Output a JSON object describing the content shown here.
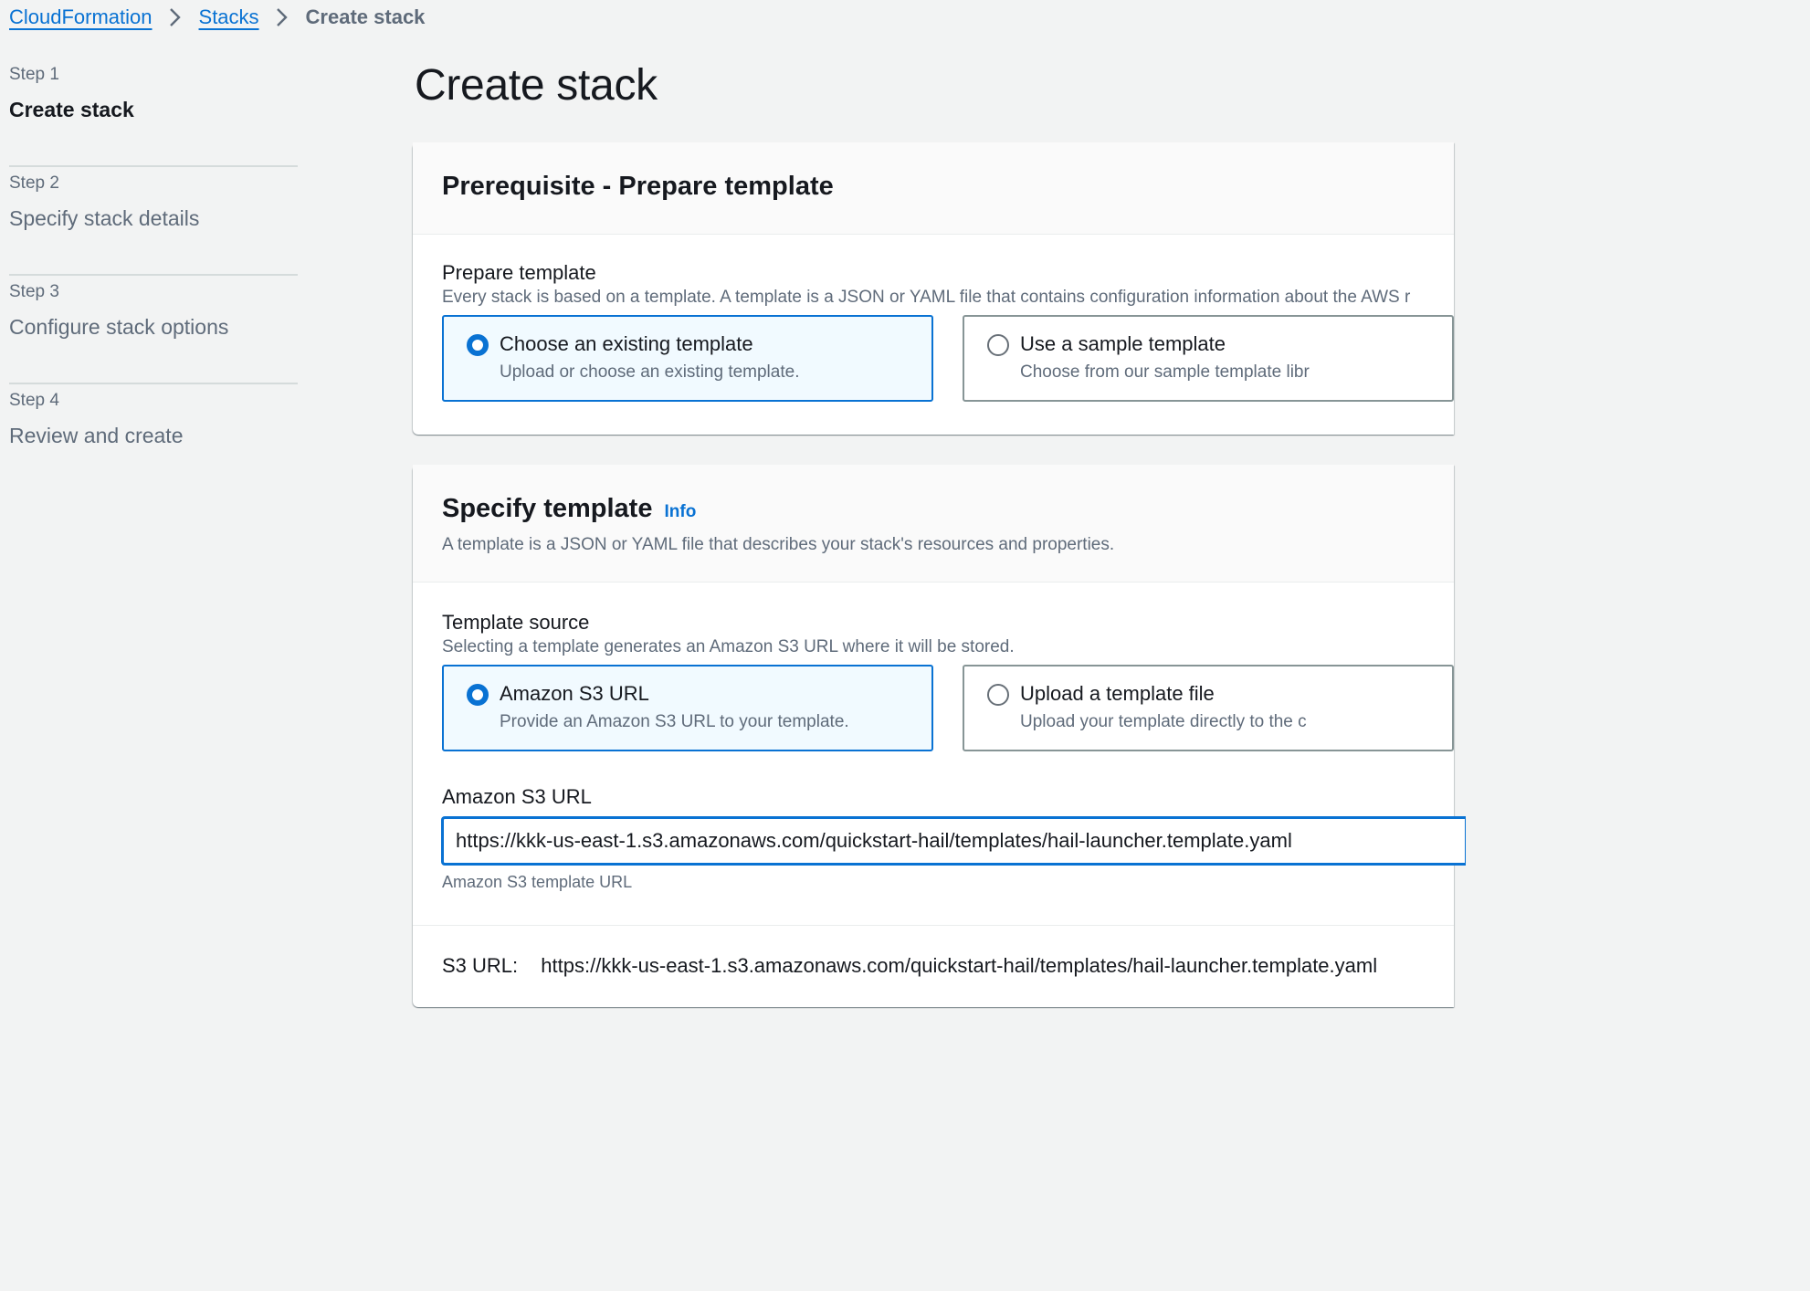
{
  "breadcrumb": {
    "items": [
      "CloudFormation",
      "Stacks"
    ],
    "current": "Create stack"
  },
  "steps": [
    {
      "num": "Step 1",
      "title": "Create stack",
      "active": true
    },
    {
      "num": "Step 2",
      "title": "Specify stack details",
      "active": false
    },
    {
      "num": "Step 3",
      "title": "Configure stack options",
      "active": false
    },
    {
      "num": "Step 4",
      "title": "Review and create",
      "active": false
    }
  ],
  "page_title": "Create stack",
  "prerequisite": {
    "heading": "Prerequisite - Prepare template",
    "label": "Prepare template",
    "description": "Every stack is based on a template. A template is a JSON or YAML file that contains configuration information about the AWS r",
    "options": [
      {
        "title": "Choose an existing template",
        "desc": "Upload or choose an existing template.",
        "selected": true
      },
      {
        "title": "Use a sample template",
        "desc": "Choose from our sample template libr",
        "selected": false
      }
    ]
  },
  "specify": {
    "heading": "Specify template",
    "info": "Info",
    "description": "A template is a JSON or YAML file that describes your stack's resources and properties.",
    "source_label": "Template source",
    "source_description": "Selecting a template generates an Amazon S3 URL where it will be stored.",
    "options": [
      {
        "title": "Amazon S3 URL",
        "desc": "Provide an Amazon S3 URL to your template.",
        "selected": true
      },
      {
        "title": "Upload a template file",
        "desc": "Upload your template directly to the c",
        "selected": false
      }
    ],
    "url_label": "Amazon S3 URL",
    "url_value": "https://kkk-us-east-1.s3.amazonaws.com/quickstart-hail/templates/hail-launcher.template.yaml",
    "url_constraint": "Amazon S3 template URL",
    "s3_label": "S3 URL:",
    "s3_value": "https://kkk-us-east-1.s3.amazonaws.com/quickstart-hail/templates/hail-launcher.template.yaml"
  },
  "colors": {
    "link": "#0972d3",
    "selected_bg": "#f1faff",
    "page_bg": "#f2f3f3",
    "muted_text": "#5f6b7a"
  }
}
